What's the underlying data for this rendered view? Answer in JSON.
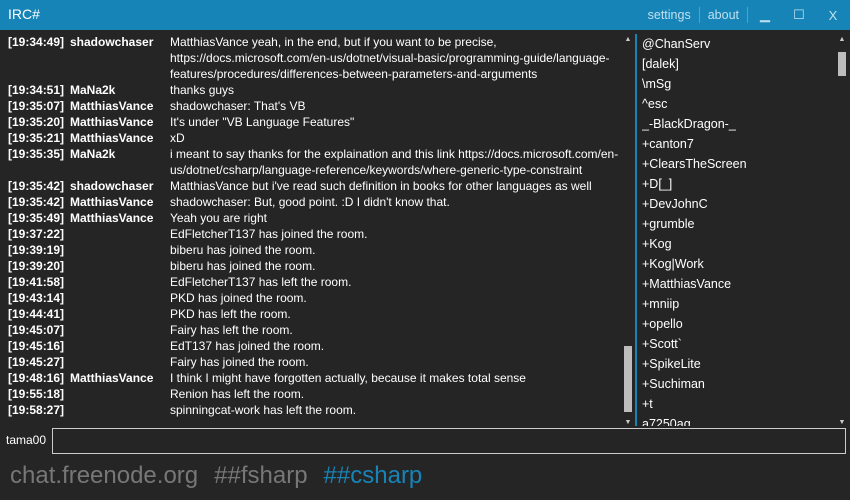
{
  "window": {
    "title": "IRC#",
    "links": [
      "settings",
      "about"
    ],
    "controls": {
      "minimize": "▁",
      "maximize": "☐",
      "close": "X"
    }
  },
  "accent": "#1784b8",
  "messages": [
    {
      "time": "[19:34:49]",
      "nick": "shadowchaser",
      "text": "MatthiasVance yeah, in the end, but if you want to be precise, https://docs.microsoft.com/en-us/dotnet/visual-basic/programming-guide/language-features/procedures/differences-between-parameters-and-arguments"
    },
    {
      "time": "[19:34:51]",
      "nick": "MaNa2k",
      "text": "thanks guys"
    },
    {
      "time": "[19:35:07]",
      "nick": "MatthiasVance",
      "text": "shadowchaser: That's VB"
    },
    {
      "time": "[19:35:20]",
      "nick": "MatthiasVance",
      "text": "It's under \"VB Language Features\""
    },
    {
      "time": "[19:35:21]",
      "nick": "MatthiasVance",
      "text": "xD"
    },
    {
      "time": "[19:35:35]",
      "nick": "MaNa2k",
      "text": "i meant to say thanks for the explaination and this link https://docs.microsoft.com/en-us/dotnet/csharp/language-reference/keywords/where-generic-type-constraint"
    },
    {
      "time": "[19:35:42]",
      "nick": "shadowchaser",
      "text": "MatthiasVance but i've read such definition in books for other languages as well"
    },
    {
      "time": "[19:35:42]",
      "nick": "MatthiasVance",
      "text": "shadowchaser: But, good point. :D I didn't know that."
    },
    {
      "time": "[19:35:49]",
      "nick": "MatthiasVance",
      "text": "Yeah you are right"
    },
    {
      "time": "[19:37:22]",
      "nick": "",
      "text": "EdFletcherT137 has joined the room."
    },
    {
      "time": "[19:39:19]",
      "nick": "",
      "text": "biberu has joined the room."
    },
    {
      "time": "[19:39:20]",
      "nick": "",
      "text": "biberu has joined the room."
    },
    {
      "time": "[19:41:58]",
      "nick": "",
      "text": "EdFletcherT137 has left the room."
    },
    {
      "time": "[19:43:14]",
      "nick": "",
      "text": "PKD has joined the room."
    },
    {
      "time": "[19:44:41]",
      "nick": "",
      "text": "PKD has left the room."
    },
    {
      "time": "[19:45:07]",
      "nick": "",
      "text": "Fairy has left the room."
    },
    {
      "time": "[19:45:16]",
      "nick": "",
      "text": "EdT137 has joined the room."
    },
    {
      "time": "[19:45:27]",
      "nick": "",
      "text": "Fairy has joined the room."
    },
    {
      "time": "[19:48:16]",
      "nick": "MatthiasVance",
      "text": "I think I might have forgotten actually, because it makes total sense"
    },
    {
      "time": "[19:55:18]",
      "nick": "",
      "text": "Renion has left the room."
    },
    {
      "time": "[19:58:27]",
      "nick": "",
      "text": "spinningcat-work has left the room."
    }
  ],
  "users": [
    "@ChanServ",
    "[dalek]",
    "\\mSg",
    "^esc",
    "_-BlackDragon-_",
    "+canton7",
    "+ClearsTheScreen",
    "+D[_]",
    "+DevJohnC",
    "+grumble",
    "+Kog",
    "+Kog|Work",
    "+MatthiasVance",
    "+mniip",
    "+opello",
    "+Scott`",
    "+SpikeLite",
    "+Suchiman",
    "+t",
    "a7250ag"
  ],
  "input": {
    "nick": "tama00",
    "value": ""
  },
  "tabs": [
    {
      "label": "chat.freenode.org",
      "active": false
    },
    {
      "label": "##fsharp",
      "active": false
    },
    {
      "label": "##csharp",
      "active": true
    }
  ]
}
